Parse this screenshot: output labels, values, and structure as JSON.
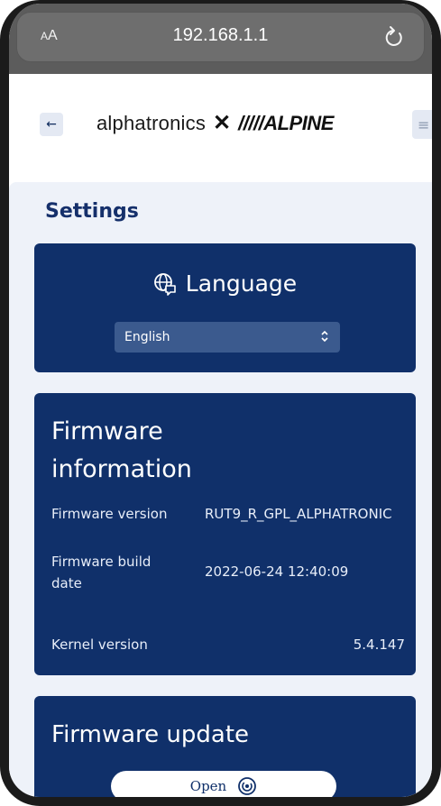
{
  "browser": {
    "text_size_label_small": "A",
    "text_size_label_large": "A",
    "url": "192.168.1.1",
    "reload_icon": "reload-icon"
  },
  "header": {
    "back_label": "←",
    "logo_text": "alphatronics",
    "logo_separator": "✕",
    "logo_brand": "/////ALPINE",
    "menu_label": "≡"
  },
  "settings": {
    "title": "Settings",
    "language": {
      "title": "Language",
      "icon": "globe-chat-icon",
      "selected": "English",
      "chevron": "⌃⌄"
    },
    "firmware_info": {
      "title_line1": "Firmware",
      "title_line2": "information",
      "rows": [
        {
          "label": "Firmware version",
          "value": "RUT9_R_GPL_ALPHATRONIC"
        },
        {
          "label_line1": "Firmware build",
          "label_line2": "date",
          "value": "2022-06-24 12:40:09"
        },
        {
          "label": "Kernel version",
          "value": "5.4.147"
        }
      ]
    },
    "firmware_update": {
      "title": "Firmware update",
      "open_label": "Open",
      "open_icon": "target-icon"
    }
  }
}
